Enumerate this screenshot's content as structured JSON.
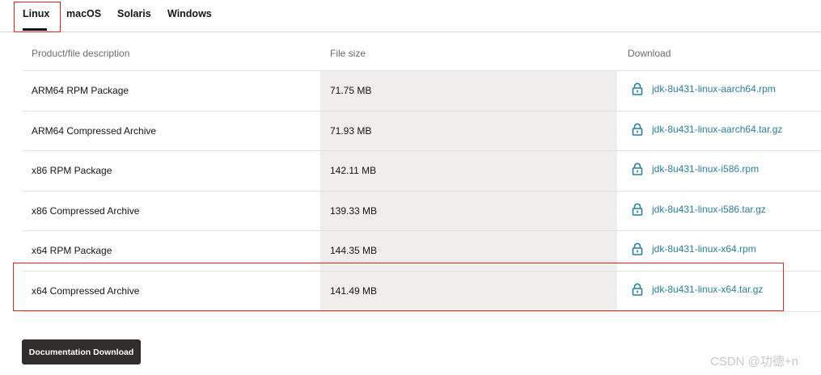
{
  "tabs": [
    {
      "label": "Linux",
      "active": true
    },
    {
      "label": "macOS"
    },
    {
      "label": "Solaris"
    },
    {
      "label": "Windows"
    }
  ],
  "table": {
    "headers": {
      "description": "Product/file description",
      "size": "File size",
      "download": "Download"
    },
    "rows": [
      {
        "description": "ARM64 RPM Package",
        "size": "71.75 MB",
        "file": "jdk-8u431-linux-aarch64.rpm"
      },
      {
        "description": "ARM64 Compressed Archive",
        "size": "71.93 MB",
        "file": "jdk-8u431-linux-aarch64.tar.gz"
      },
      {
        "description": "x86 RPM Package",
        "size": "142.11 MB",
        "file": "jdk-8u431-linux-i586.rpm"
      },
      {
        "description": "x86 Compressed Archive",
        "size": "139.33 MB",
        "file": "jdk-8u431-linux-i586.tar.gz"
      },
      {
        "description": "x64 RPM Package",
        "size": "144.35 MB",
        "file": "jdk-8u431-linux-x64.rpm"
      },
      {
        "description": "x64 Compressed Archive",
        "size": "141.49 MB",
        "file": "jdk-8u431-linux-x64.tar.gz"
      }
    ]
  },
  "doc_button": {
    "label": "Documentation Download"
  },
  "watermark": "CSDN @功德+n",
  "colors": {
    "link": "#2a7f99",
    "highlight": "#e1251b",
    "button": "#312d2a",
    "size_column_bg": "#f0eeec"
  },
  "icons": {
    "download": "lock-icon"
  }
}
